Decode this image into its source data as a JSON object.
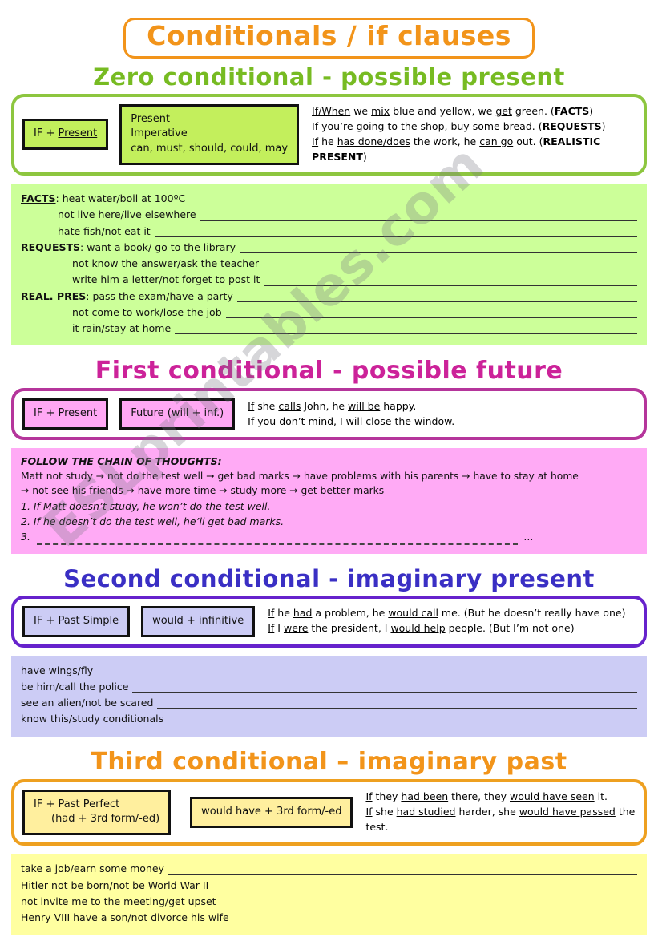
{
  "title": "Conditionals / if clauses",
  "watermark": "ESLprintables.com",
  "colors": {
    "orange": "#f2941a",
    "green": "#77bb22",
    "pink": "#cc2299",
    "purple": "#3a2fc4",
    "green_fill": "#ccff99",
    "pink_fill": "#ffaaf5",
    "purple_fill": "#ccccf5",
    "yellow_fill": "#ffffa0"
  },
  "zero": {
    "heading": "Zero conditional - possible present",
    "formula_left": "IF + Present",
    "formula_right_line1": "Present",
    "formula_right_line2": "Imperative",
    "formula_right_line3": "can, must, should, could, may",
    "examples": [
      "If/When we mix blue and yellow, we get green. (FACTS)",
      "If you’re going to the shop, buy some bread. (REQUESTS)",
      "If he has done/does the work, he can go out. (REALISTIC PRESENT)"
    ],
    "exercise": [
      {
        "label": "FACTS",
        "prompt": "heat water/boil at 100ºC",
        "indent": 0
      },
      {
        "label": "",
        "prompt": "not live here/live elsewhere",
        "indent": 1
      },
      {
        "label": "",
        "prompt": "hate fish/not eat it",
        "indent": 1
      },
      {
        "label": "REQUESTS",
        "prompt": "want a book/ go to the library",
        "indent": 0
      },
      {
        "label": "",
        "prompt": "not know the answer/ask the teacher",
        "indent": 2
      },
      {
        "label": "",
        "prompt": "write him a letter/not forget to post it",
        "indent": 2
      },
      {
        "label": "REAL. PRES",
        "prompt": "pass the exam/have a party",
        "indent": 0
      },
      {
        "label": "",
        "prompt": "not come to work/lose the job",
        "indent": 2
      },
      {
        "label": "",
        "prompt": "it rain/stay at home",
        "indent": 2
      }
    ]
  },
  "first": {
    "heading": "First conditional - possible future",
    "formula_left": "IF + Present",
    "formula_right": "Future (will + inf.)",
    "examples": [
      "If she calls John, he will be happy.",
      "If you don’t mind, I will close the window."
    ],
    "chain_title": "FOLLOW THE CHAIN OF THOUGHTS:",
    "chain_line1": "Matt not study → not do the test well → get bad marks → have problems with his parents → have to stay at home",
    "chain_line2": "→ not see his friends → have more time → study more → get better marks",
    "numbered": [
      "1. If Matt doesn’t study, he won’t do the test well.",
      "2. If he doesn’t do the test well, he’ll get bad marks."
    ],
    "blank_number": "3.",
    "blank_tail": "..."
  },
  "second": {
    "heading": "Second conditional - imaginary present",
    "formula_left": "IF + Past Simple",
    "formula_right": "would + infinitive",
    "examples": [
      "If he had a problem, he would call me. (But he doesn’t really have one)",
      "If I were the president, I would help people. (But I’m not one)"
    ],
    "exercise": [
      {
        "prompt": "have wings/fly"
      },
      {
        "prompt": "be him/call the police"
      },
      {
        "prompt": "see an alien/not be scared"
      },
      {
        "prompt": "know this/study conditionals"
      }
    ]
  },
  "third": {
    "heading": "Third conditional – imaginary past",
    "formula_left_line1": "IF + Past Perfect",
    "formula_left_line2": "(had + 3rd form/-ed)",
    "formula_right": "would have + 3rd form/-ed",
    "examples": [
      "If they had been there, they would have seen it.",
      "If she had studied harder, she would have passed the test."
    ],
    "exercise": [
      {
        "prompt": "take a job/earn some money"
      },
      {
        "prompt": "Hitler not be born/not be World War II"
      },
      {
        "prompt": "not invite me to the meeting/get upset"
      },
      {
        "prompt": "Henry VIII have a son/not divorce his wife"
      }
    ]
  }
}
